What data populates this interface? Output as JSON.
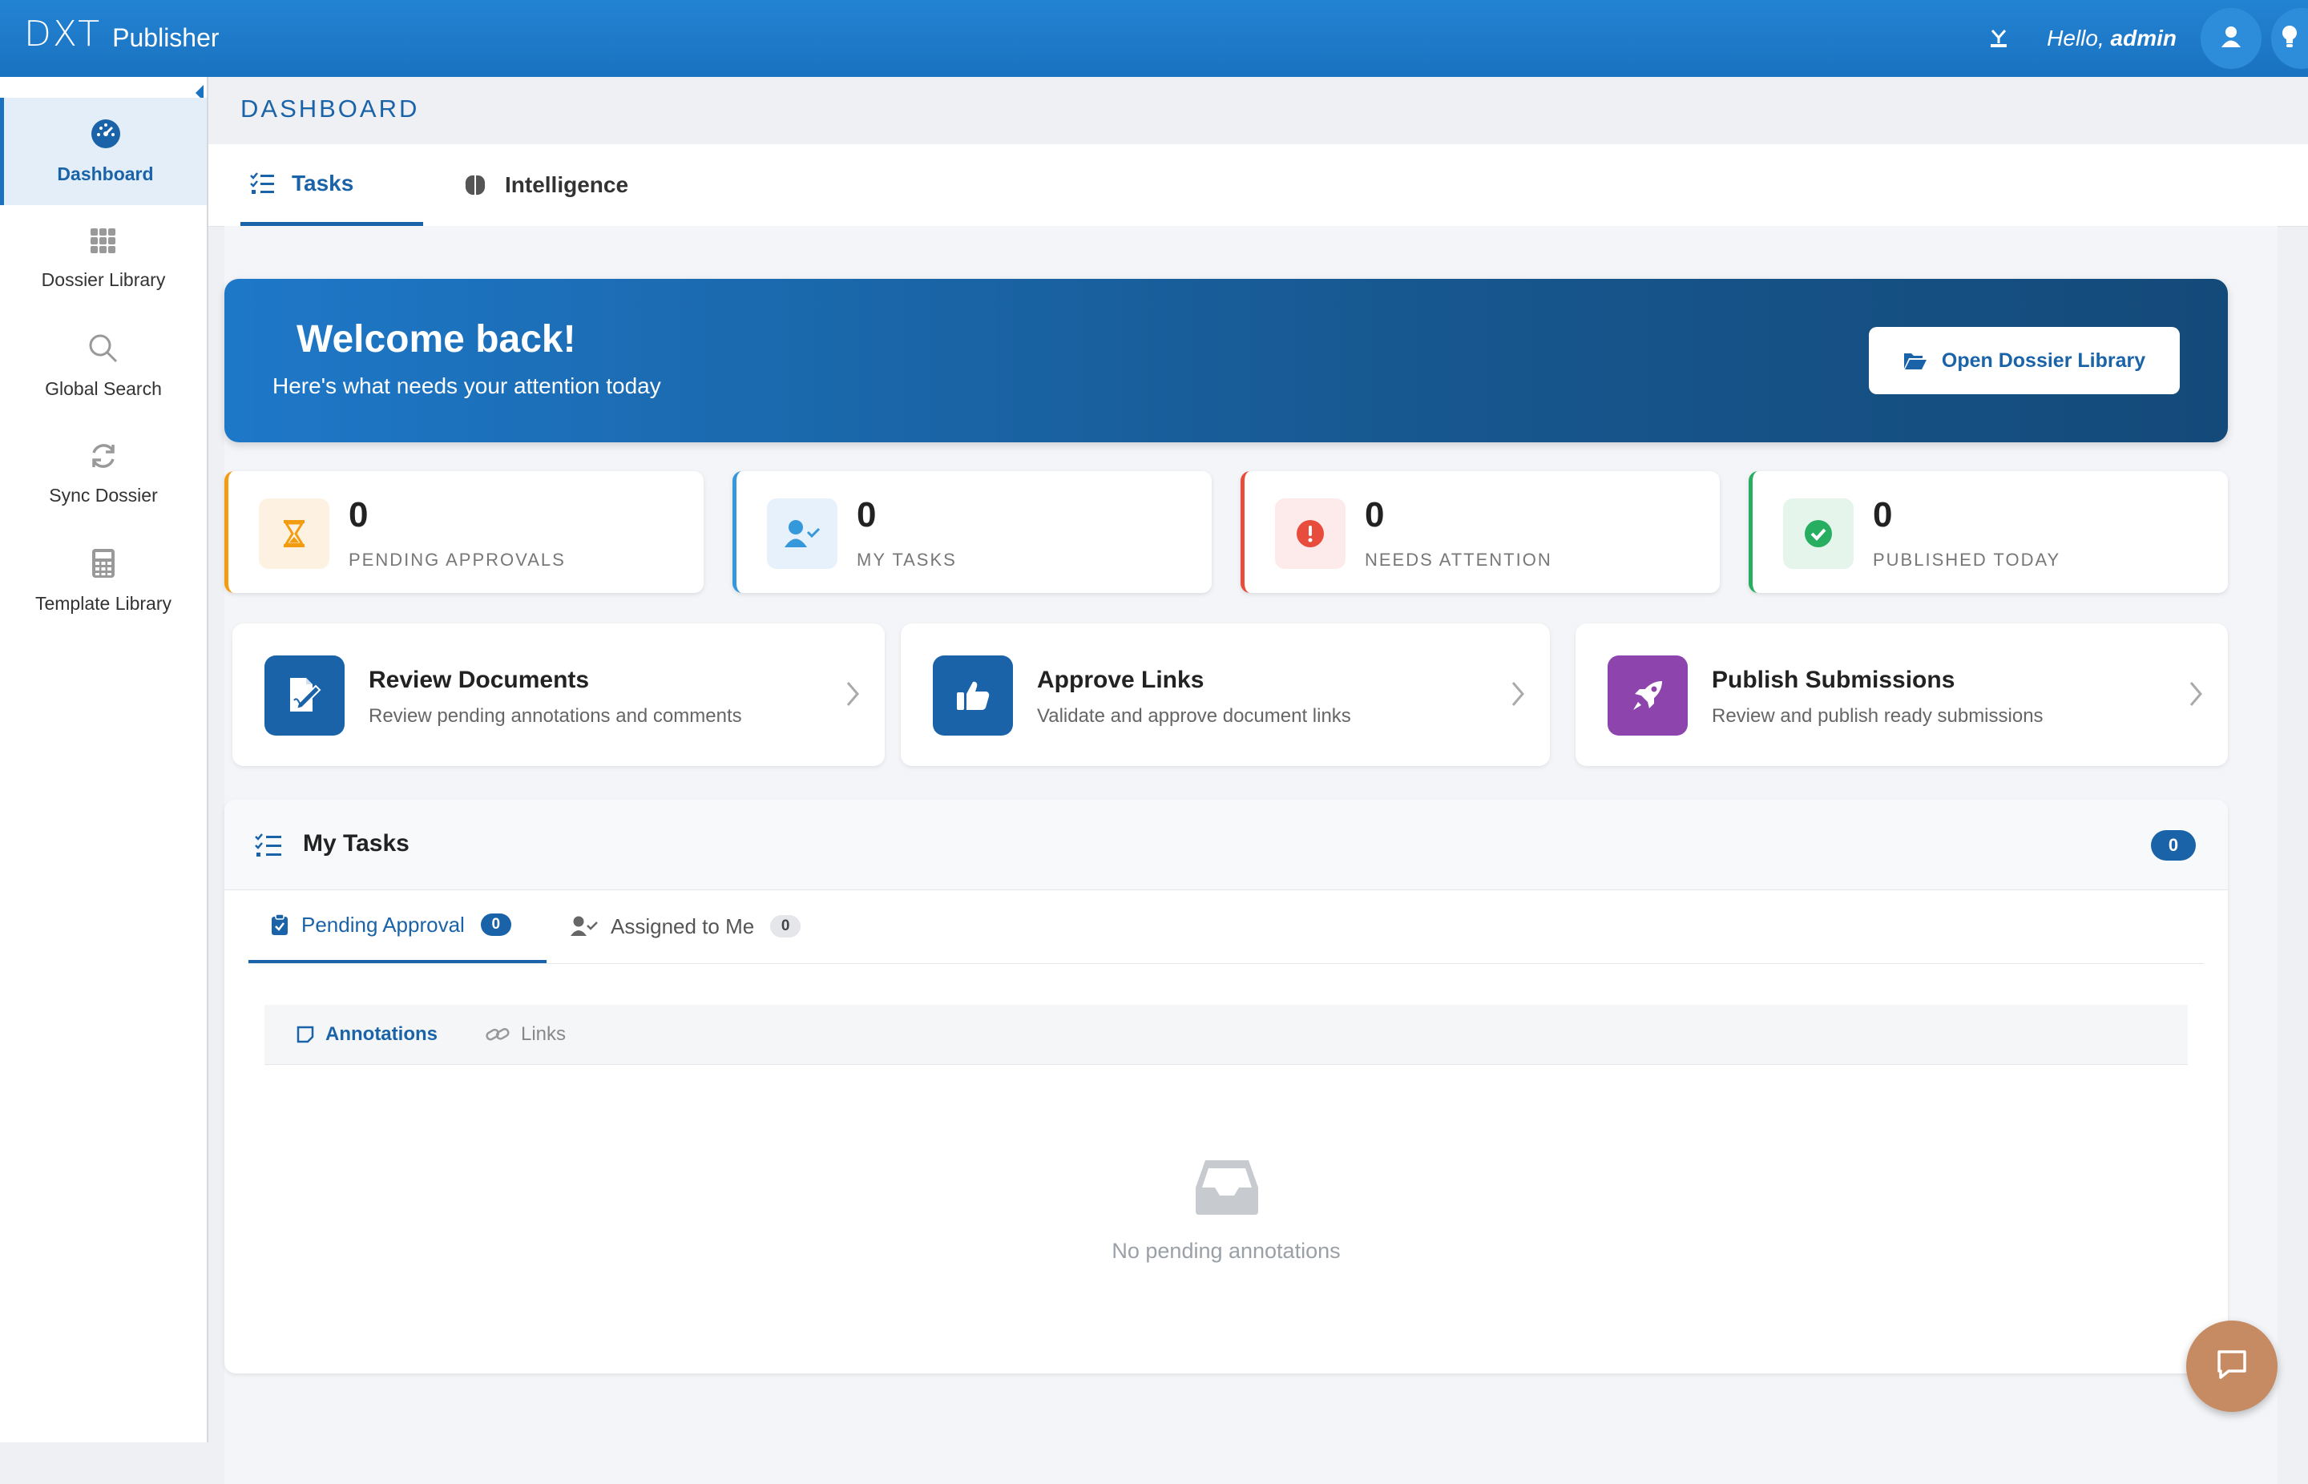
{
  "app": {
    "logo_mark": "DXT",
    "logo_name": "Publisher"
  },
  "header": {
    "greeting": "Hello,",
    "username": "admin"
  },
  "sidebar": {
    "items": [
      {
        "label": "Dashboard",
        "icon": "gauge-icon",
        "active": true
      },
      {
        "label": "Dossier Library",
        "icon": "grid-icon"
      },
      {
        "label": "Global Search",
        "icon": "search-icon"
      },
      {
        "label": "Sync Dossier",
        "icon": "sync-icon"
      },
      {
        "label": "Template Library",
        "icon": "calculator-icon"
      }
    ]
  },
  "page": {
    "title": "DASHBOARD"
  },
  "tabs": [
    {
      "label": "Tasks",
      "icon": "tasks-list-icon",
      "active": true
    },
    {
      "label": "Intelligence",
      "icon": "brain-icon"
    }
  ],
  "welcome": {
    "title": "Welcome back!",
    "subtitle": "Here's what needs your attention today",
    "button_label": "Open Dossier Library"
  },
  "stats": [
    {
      "value": "0",
      "label": "PENDING APPROVALS",
      "color": "#f39c12",
      "icon": "hourglass-icon"
    },
    {
      "value": "0",
      "label": "MY TASKS",
      "color": "#3498db",
      "icon": "user-check-icon"
    },
    {
      "value": "0",
      "label": "NEEDS ATTENTION",
      "color": "#e74c3c",
      "icon": "alert-icon"
    },
    {
      "value": "0",
      "label": "PUBLISHED TODAY",
      "color": "#27ae60",
      "icon": "check-circle-icon"
    }
  ],
  "actions": [
    {
      "title": "Review Documents",
      "subtitle": "Review pending annotations and comments",
      "color": "#1a63a8",
      "icon": "document-edit-icon"
    },
    {
      "title": "Approve Links",
      "subtitle": "Validate and approve document links",
      "color": "#1a63a8",
      "icon": "thumbs-up-icon"
    },
    {
      "title": "Publish Submissions",
      "subtitle": "Review and publish ready submissions",
      "color": "#8e44ad",
      "icon": "rocket-icon"
    }
  ],
  "my_tasks": {
    "title": "My Tasks",
    "count": "0",
    "tabs": [
      {
        "label": "Pending Approval",
        "count": "0",
        "active": true
      },
      {
        "label": "Assigned to Me",
        "count": "0"
      }
    ],
    "subtabs": [
      {
        "label": "Annotations",
        "active": true
      },
      {
        "label": "Links"
      }
    ],
    "empty_text": "No pending annotations"
  },
  "colors": {
    "primary": "#1a63a8",
    "topbar": "#1a72c0",
    "chat": "#c68b62"
  }
}
